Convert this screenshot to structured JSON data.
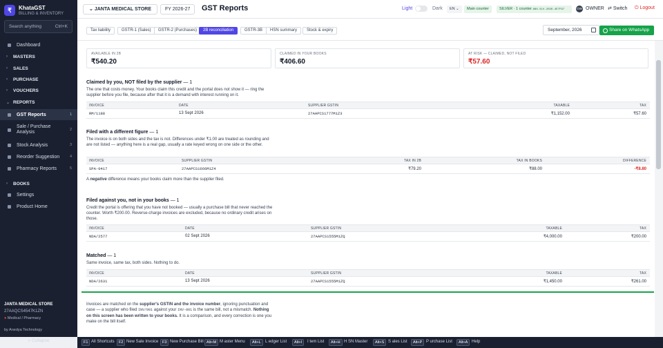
{
  "app": {
    "name": "KhataGST",
    "subtitle": "BILLING & INVENTORY",
    "logo_glyph": "₹"
  },
  "search": {
    "placeholder": "Search anything",
    "shortcut": "Ctrl+K"
  },
  "sidebar": {
    "items": [
      {
        "label": "Dashboard"
      },
      {
        "label": "MASTERS"
      },
      {
        "label": "SALES"
      },
      {
        "label": "PURCHASE"
      },
      {
        "label": "VOUCHERS"
      },
      {
        "label": "REPORTS"
      },
      {
        "label": "GST Reports",
        "key": "1"
      },
      {
        "label": "Sale / Purchase",
        "label2": "Analysis",
        "key": "2"
      },
      {
        "label": "Stock Analysis",
        "key": "3"
      },
      {
        "label": "Reorder Suggestion",
        "key": "4"
      },
      {
        "label": "Pharmacy Reports",
        "key": "5"
      },
      {
        "label": "BOOKS"
      },
      {
        "label": "Settings"
      },
      {
        "label": "Product Home"
      }
    ],
    "shop_name": "JANTA MEDICAL STORE",
    "shop_gstin": "27AAQCS4547K1ZN",
    "shop_type": "Medical / Pharmacy",
    "credit": "by Anedya Technology",
    "collapse": "« Collapse"
  },
  "topbar": {
    "shop": "JANTA MEDICAL STORE",
    "fy": "FY 2026-27",
    "title": "GST Reports",
    "light": "Light",
    "dark": "Dark",
    "lang": "EN",
    "counter": "Main counter",
    "license": "SILVER · 1 counter",
    "license_key": "ANX-SLV-2026-4E7F97",
    "avatar": "OW",
    "user": "OWNER",
    "switch": "Switch",
    "logout": "Logout"
  },
  "tabs": [
    "Tax liability",
    "GSTR-1 (Sales)",
    "GSTR-2 (Purchases)",
    "2B reconciliation",
    "GSTR-3B",
    "HSN summary",
    "Stock & expiry"
  ],
  "active_tab": "2B reconciliation",
  "month": "September, 2026",
  "whatsapp": "Share on WhatsApp",
  "summary": [
    {
      "label": "AVAILABLE IN 2B",
      "value": "₹540.20"
    },
    {
      "label": "CLAIMED IN YOUR BOOKS",
      "value": "₹406.60"
    },
    {
      "label": "AT RISK — CLAIMED, NOT FILED",
      "value": "₹57.60"
    }
  ],
  "sec1": {
    "title": "Claimed by you, NOT filed by the supplier",
    "count": " — 1",
    "desc": "The one that costs money. Your books claim this credit and the portal does not show it — ring the supplier before you file, because after that it is a demand with interest running on it.",
    "headers": [
      "INVOICE",
      "DATE",
      "SUPPLIER GSTIN",
      "TAXABLE",
      "TAX"
    ],
    "rows": [
      [
        "RM/1188",
        "13 Sept 2026",
        "27AAPCS1777M1Z3",
        "₹1,152.00",
        "₹57.60"
      ]
    ]
  },
  "sec2": {
    "title": "Filed with a different figure",
    "count": " — 1",
    "desc": "The invoice is on both sides and the tax is not. Differences under ₹1.00 are treated as rounding and are not listed — anything here is a real gap, usually a rate keyed wrong on one side or the other.",
    "headers": [
      "INVOICE",
      "SUPPLIER GSTIN",
      "TAX IN 2B",
      "TAX IN BOOKS",
      "DIFFERENCE"
    ],
    "rows": [
      [
        "SPA-0417",
        "27AAPCS1666M1Z4",
        "₹79.20",
        "₹88.00",
        "-₹8.80"
      ]
    ],
    "note_a": "A ",
    "note_b": "negative",
    "note_c": " difference means your books claim more than the supplier filed."
  },
  "sec3": {
    "title": "Filed against you, not in your books",
    "count": " — 1",
    "desc": "Credit the portal is offering that you have not booked — usually a purchase bill that never reached the counter. Worth ₹200.00. Reverse-charge invoices are excluded, because no ordinary credit arises on those.",
    "headers": [
      "INVOICE",
      "DATE",
      "SUPPLIER GSTIN",
      "TAXABLE",
      "TAX"
    ],
    "rows": [
      [
        "NDA/2577",
        "02 Sept 2026",
        "27AAPCS1555M1ZQ",
        "₹4,000.00",
        "₹200.00"
      ]
    ]
  },
  "sec4": {
    "title": "Matched",
    "count": " — 1",
    "desc": "Same invoice, same tax, both sides. Nothing to do.",
    "headers": [
      "INVOICE",
      "DATE",
      "SUPPLIER GSTIN",
      "TAXABLE",
      "TAX"
    ],
    "rows": [
      [
        "NDA/2631",
        "13 Sept 2026",
        "27AAPCS1555M1ZQ",
        "₹1,450.00",
        "₹261.00"
      ]
    ]
  },
  "footer_note": {
    "p1": "Invoices are matched on the ",
    "b1": "supplier's GSTIN and the invoice number",
    "p2": ", ignoring punctuation and case — a supplier who filed ",
    "c1": "INV/001",
    "p3": " against your ",
    "c2": "INV-001",
    "p4": " is the same bill, not a mismatch. ",
    "b2": "Nothing on this screen has been written to your books.",
    "p5": " It is a comparison, and every correction is one you make on the bill itself."
  },
  "shortcuts": [
    {
      "key": "F1",
      "label": "All Shortcuts"
    },
    {
      "key": "F2",
      "label": "New Sale Invoice"
    },
    {
      "key": "F3",
      "label": "New Purchase Bill"
    },
    {
      "key": "Alt+M",
      "label": "M aster Menu"
    },
    {
      "key": "Alt+L",
      "label": "L edger List"
    },
    {
      "key": "Alt+I",
      "label": "I tem List"
    },
    {
      "key": "Alt+H",
      "label": "H SN Master"
    },
    {
      "key": "Alt+S",
      "label": "S ales List"
    },
    {
      "key": "Alt+P",
      "label": "P urchase List"
    },
    {
      "key": "Alt+A",
      "label": "Help"
    }
  ],
  "colors": {
    "accent": "#4f46e5",
    "sidebar": "#1a2030",
    "success": "#16a34a",
    "danger": "#dc2626"
  }
}
